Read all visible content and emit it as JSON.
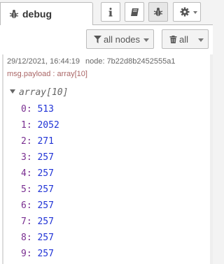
{
  "tab": {
    "label": "debug",
    "icon": "bug-icon"
  },
  "header_buttons": [
    {
      "name": "info-button",
      "icon": "info-icon"
    },
    {
      "name": "book-button",
      "icon": "book-icon"
    },
    {
      "name": "debug-button",
      "icon": "bug-icon"
    },
    {
      "name": "settings-button",
      "icon": "gear-icon"
    }
  ],
  "toolbar": {
    "filter_nodes_label": "all nodes",
    "clear_label": "all"
  },
  "message": {
    "timestamp": "29/12/2021, 16:44:19",
    "node": "node: 7b22d8b2452555a1",
    "topic": "msg.payload : array[10]",
    "array_label": "array[10]",
    "items": [
      {
        "index": "0",
        "value": "513"
      },
      {
        "index": "1",
        "value": "2052"
      },
      {
        "index": "2",
        "value": "271"
      },
      {
        "index": "3",
        "value": "257"
      },
      {
        "index": "4",
        "value": "257"
      },
      {
        "index": "5",
        "value": "257"
      },
      {
        "index": "6",
        "value": "257"
      },
      {
        "index": "7",
        "value": "257"
      },
      {
        "index": "8",
        "value": "257"
      },
      {
        "index": "9",
        "value": "257"
      }
    ]
  },
  "colors": {
    "index": "#792e90",
    "value": "#2033d6",
    "topic": "#a66"
  }
}
